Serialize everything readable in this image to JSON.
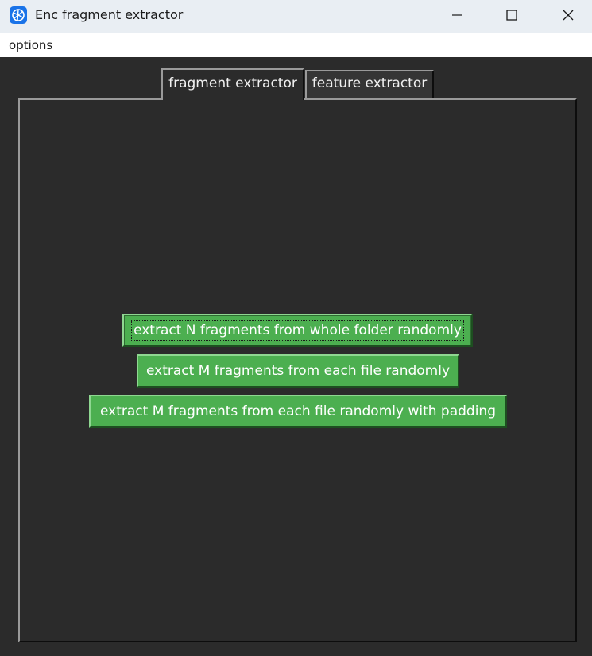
{
  "window": {
    "title": "Enc fragment extractor",
    "controls": {
      "minimize_icon": "minimize-icon",
      "maximize_icon": "maximize-icon",
      "close_icon": "close-icon"
    }
  },
  "menubar": {
    "items": [
      {
        "label": "options"
      }
    ]
  },
  "tabs": [
    {
      "label": "fragment extractor",
      "active": true
    },
    {
      "label": "feature extractor",
      "active": false
    }
  ],
  "buttons": {
    "extract_n_whole_folder": "extract N fragments from whole folder randomly",
    "extract_m_each_file": "extract M fragments from each file randomly",
    "extract_m_each_file_padding": "extract M fragments from each file randomly with padding"
  },
  "colors": {
    "window_bg": "#2b2b2b",
    "titlebar_bg": "#e9eef3",
    "menubar_bg": "#ffffff",
    "button_green": "#4caf50",
    "app_icon_blue": "#1a73e8"
  }
}
